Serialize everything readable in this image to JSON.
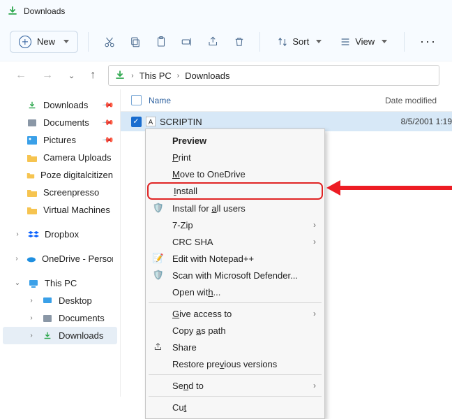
{
  "titlebar": {
    "title": "Downloads"
  },
  "toolbar": {
    "new_label": "New",
    "sort_label": "Sort",
    "view_label": "View"
  },
  "address": {
    "seg1": "This PC",
    "seg2": "Downloads"
  },
  "sidebar": {
    "items": [
      {
        "label": "Downloads",
        "pinned": true
      },
      {
        "label": "Documents",
        "pinned": true
      },
      {
        "label": "Pictures",
        "pinned": true
      },
      {
        "label": "Camera Uploads"
      },
      {
        "label": "Poze digitalcitizen"
      },
      {
        "label": "Screenpresso"
      },
      {
        "label": "Virtual Machines"
      }
    ],
    "dropbox": "Dropbox",
    "onedrive": "OneDrive - Personal",
    "thispc": "This PC",
    "thispc_children": [
      {
        "label": "Desktop"
      },
      {
        "label": "Documents"
      },
      {
        "label": "Downloads"
      }
    ]
  },
  "columns": {
    "name": "Name",
    "date": "Date modified"
  },
  "file": {
    "name": "SCRIPTIN",
    "date": "8/5/2001 1:19"
  },
  "menu": {
    "preview": "Preview",
    "print": "Print",
    "move_onedrive": "Move to OneDrive",
    "install": "Install",
    "install_all": "Install for all users",
    "sevenzip": "7-Zip",
    "crcsha": "CRC SHA",
    "notepadpp": "Edit with Notepad++",
    "defender": "Scan with Microsoft Defender...",
    "openwith": "Open with...",
    "giveaccess": "Give access to",
    "copypath": "Copy as path",
    "share": "Share",
    "restore": "Restore previous versions",
    "sendto": "Send to",
    "cut": "Cut"
  }
}
